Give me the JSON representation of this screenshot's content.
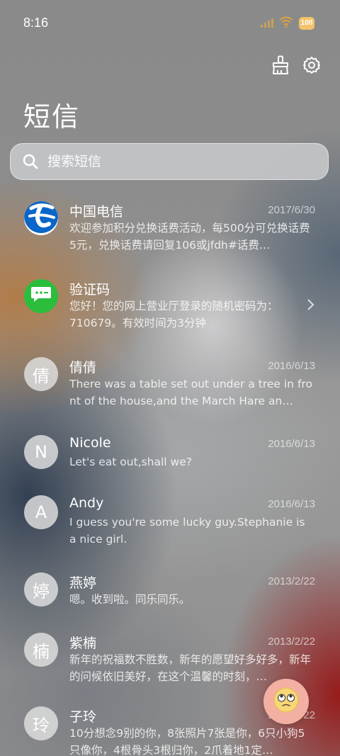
{
  "status": {
    "time": "8:16",
    "battery": "100",
    "signal_icon": "signal-icon",
    "wifi_icon": "wifi-icon"
  },
  "header": {
    "title": "短信",
    "clean_icon": "broom-icon",
    "settings_icon": "gear-icon"
  },
  "search": {
    "placeholder": "搜索短信"
  },
  "conversations": [
    {
      "avatar_text": "",
      "avatar_icon": "china-telecom-logo-icon",
      "name": "中国电信",
      "date": "2017/6/30",
      "preview": "欢迎参加积分兑换话费活动，每500分可兑换话费5元，兑换话费请回复106或jfdh#话费…"
    },
    {
      "avatar_text": "",
      "avatar_icon": "verification-code-icon",
      "name": "验证码",
      "date": "",
      "preview": "您好！您的网上营业厅登录的随机密码为：710679。有效时间为3分钟"
    },
    {
      "avatar_text": "倩",
      "name": "倩倩",
      "date": "2016/6/13",
      "preview": "There was a table set out under a tree in front of the house,and the March Hare an…"
    },
    {
      "avatar_text": "N",
      "name": "Nicole",
      "date": "2016/6/13",
      "preview": "Let's eat out,shall we?"
    },
    {
      "avatar_text": "A",
      "name": "Andy",
      "date": "2016/6/13",
      "preview": "I guess you're some lucky guy.Stephanie is a nice girl."
    },
    {
      "avatar_text": "婷",
      "name": "燕婷",
      "date": "2013/2/22",
      "preview": "嗯。收到啦。同乐同乐。"
    },
    {
      "avatar_text": "楠",
      "name": "紫楠",
      "date": "2013/2/22",
      "preview": "新年的祝福数不胜数，新年的愿望好多好多，新年的问候依旧美好，在这个温馨的时刻，…"
    },
    {
      "avatar_text": "玲",
      "name": "子玲",
      "date": "2013/2/22",
      "preview": "10分想念9别的你，8张照片7张是你，6只小狗5只像你，4根骨头3根归你，2爪着地1定…"
    }
  ],
  "fab": {
    "icon": "face-emoji-icon"
  },
  "colors": {
    "verification_green": "#2bbd3b",
    "telecom_blue": "#0066cc",
    "battery_yellow": "#f2c36a",
    "fab_background": "#f3b0a2"
  }
}
